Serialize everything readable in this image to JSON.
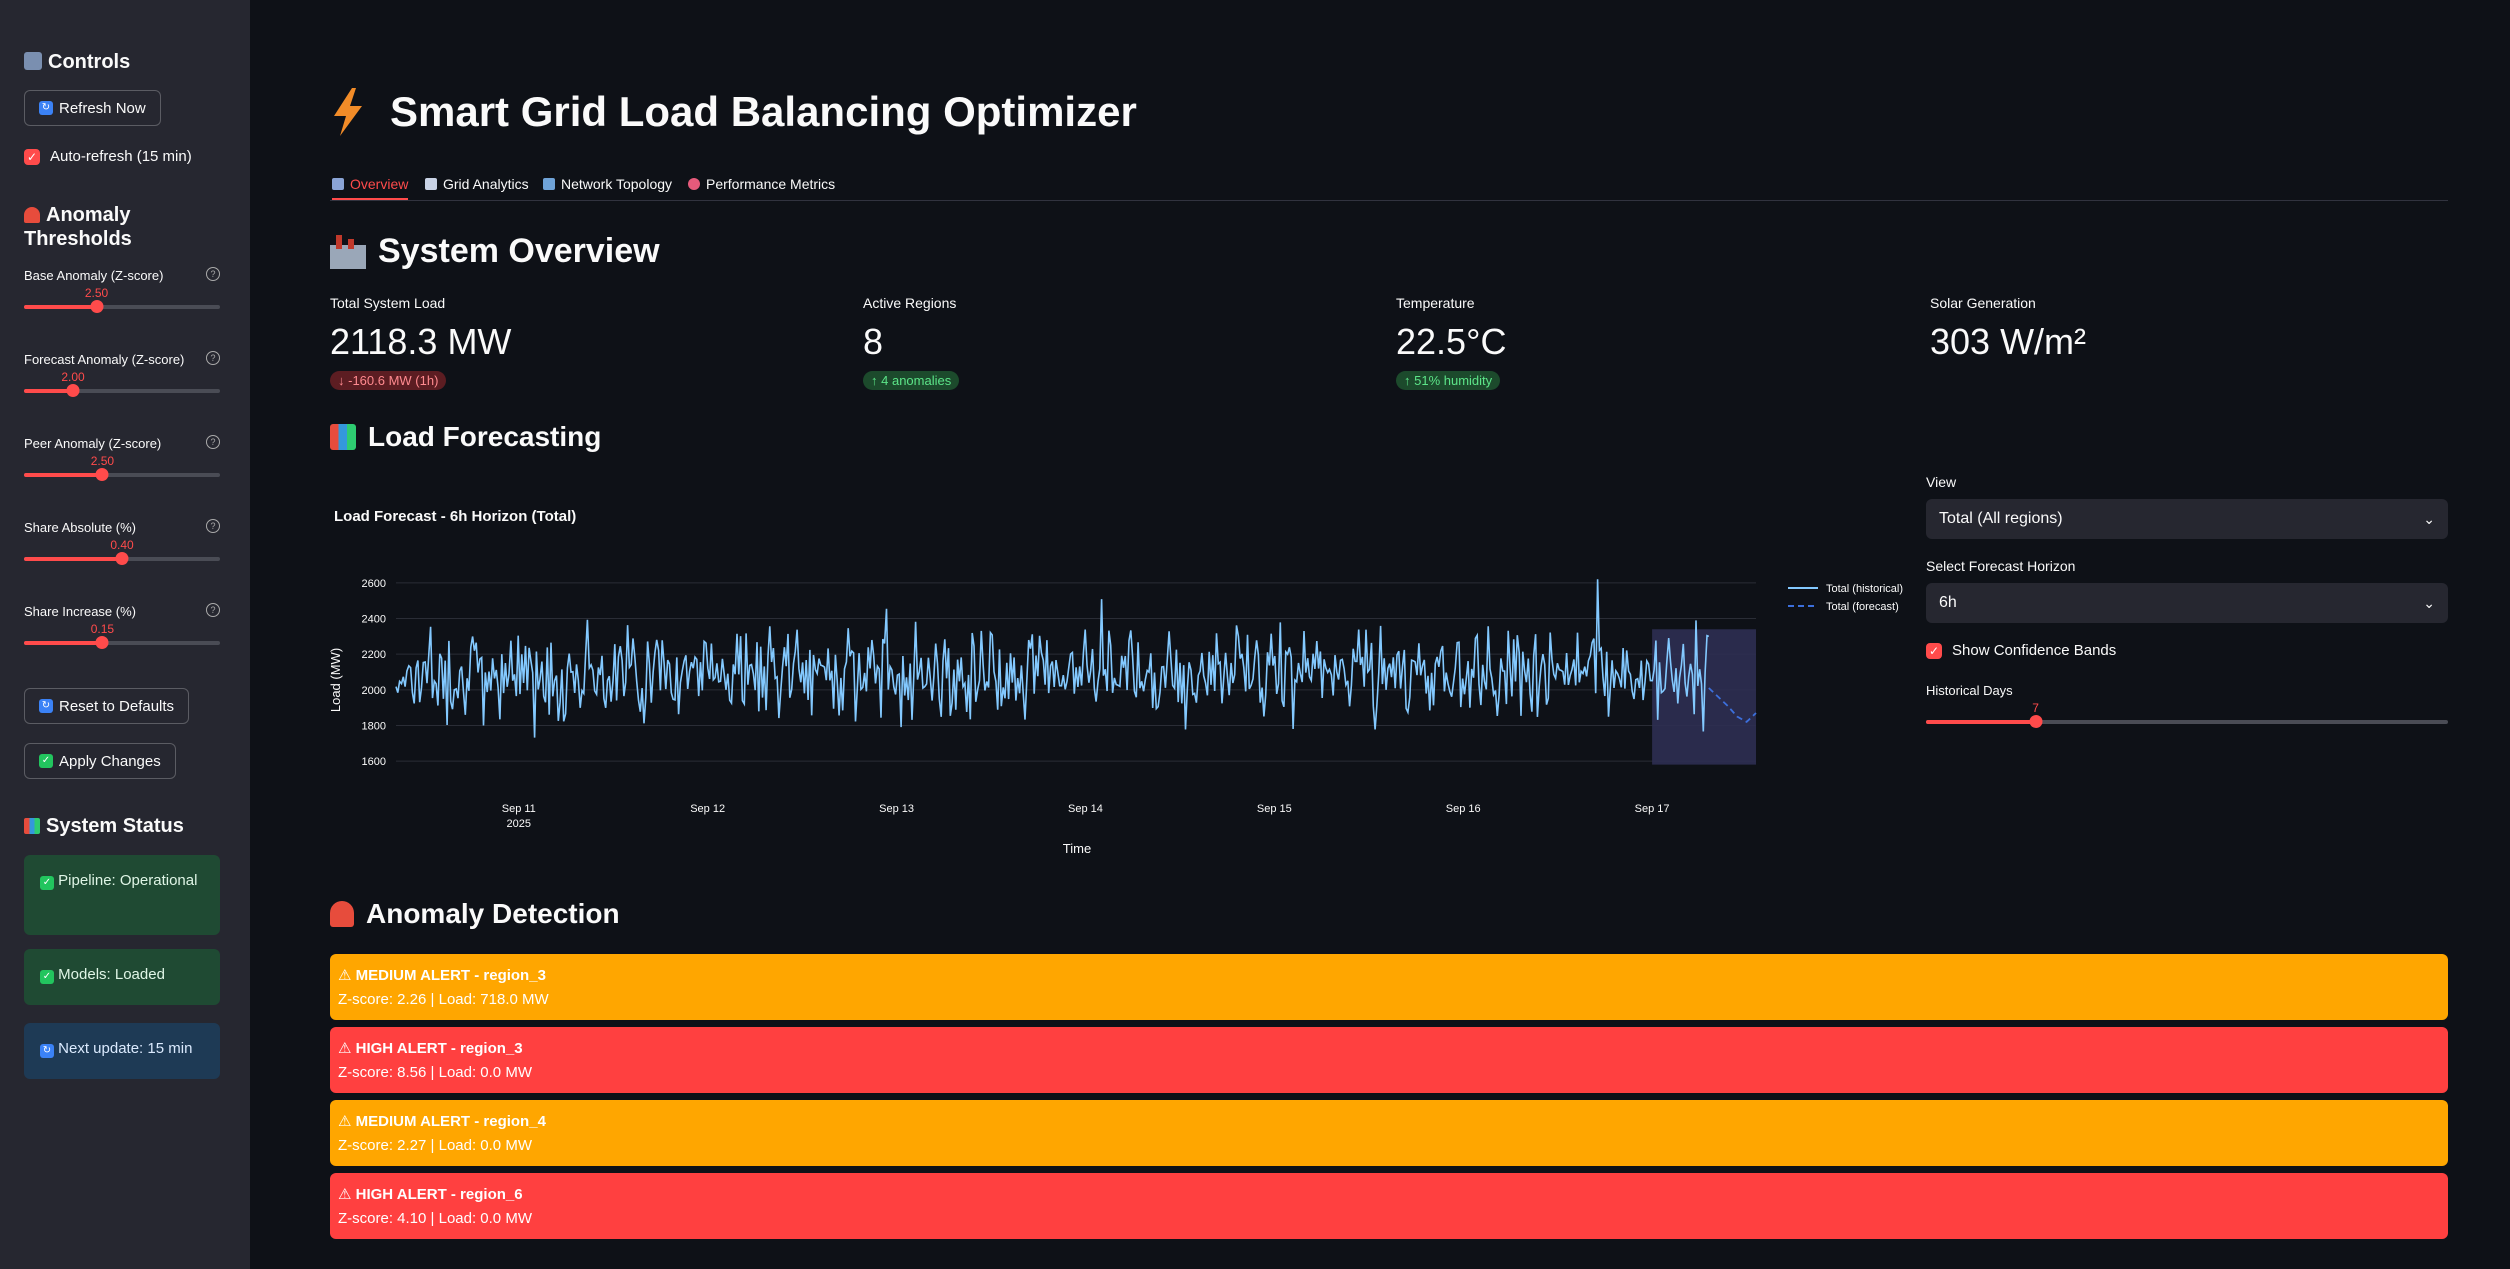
{
  "sidebar": {
    "controls_title": "Controls",
    "refresh_label": "Refresh Now",
    "autorefresh_label": "Auto-refresh (15 min)",
    "anomaly_title": "Anomaly Thresholds",
    "sliders": [
      {
        "label": "Base Anomaly (Z-score)",
        "value": "2.50",
        "fraction": 0.37
      },
      {
        "label": "Forecast Anomaly (Z-score)",
        "value": "2.00",
        "fraction": 0.25
      },
      {
        "label": "Peer Anomaly (Z-score)",
        "value": "2.50",
        "fraction": 0.4
      },
      {
        "label": "Share Absolute (%)",
        "value": "0.40",
        "fraction": 0.5
      },
      {
        "label": "Share Increase (%)",
        "value": "0.15",
        "fraction": 0.4
      }
    ],
    "reset_label": "Reset to Defaults",
    "apply_label": "Apply Changes",
    "status_title": "System Status",
    "status_pipeline": "Pipeline: Operational",
    "status_models": "Models: Loaded",
    "status_next": "Next update: 15 min"
  },
  "header": {
    "title": "Smart Grid Load Balancing Optimizer"
  },
  "tabs": [
    {
      "label": "Overview",
      "active": true
    },
    {
      "label": "Grid Analytics",
      "active": false
    },
    {
      "label": "Network Topology",
      "active": false
    },
    {
      "label": "Performance Metrics",
      "active": false
    }
  ],
  "overview": {
    "title": "System Overview",
    "metrics": [
      {
        "label": "Total System Load",
        "value": "2118.3 MW",
        "delta": "-160.6 MW (1h)",
        "delta_dir": "down"
      },
      {
        "label": "Active Regions",
        "value": "8",
        "delta": "4 anomalies",
        "delta_dir": "up"
      },
      {
        "label": "Temperature",
        "value": "22.5°C",
        "delta": "51% humidity",
        "delta_dir": "up"
      },
      {
        "label": "Solar Generation",
        "value": "303 W/m²",
        "delta": "",
        "delta_dir": ""
      }
    ]
  },
  "forecast": {
    "title": "Load Forecasting",
    "view_label": "View",
    "view_value": "Total (All regions)",
    "horizon_label": "Select Forecast Horizon",
    "horizon_value": "6h",
    "confidence_label": "Show Confidence Bands",
    "days_label": "Historical Days",
    "days_value": "7",
    "days_fraction": 0.21
  },
  "chart_data": {
    "type": "line",
    "title": "Load Forecast - 6h Horizon (Total)",
    "xlabel": "Time",
    "ylabel": "Load (MW)",
    "ylim": [
      1550,
      2650
    ],
    "yticks": [
      1600,
      1800,
      2000,
      2200,
      2400,
      2600
    ],
    "xticks": [
      {
        "label": "Sep 11",
        "sub": "2025"
      },
      {
        "label": "Sep 12",
        "sub": ""
      },
      {
        "label": "Sep 13",
        "sub": ""
      },
      {
        "label": "Sep 14",
        "sub": ""
      },
      {
        "label": "Sep 15",
        "sub": ""
      },
      {
        "label": "Sep 16",
        "sub": ""
      },
      {
        "label": "Sep 17",
        "sub": ""
      }
    ],
    "x_range_days": [
      -0.65,
      6.55
    ],
    "grid": true,
    "legend_position": "top-right",
    "series": [
      {
        "name": "Total (historical)",
        "style": "solid",
        "color": "#83c9ff",
        "x_start_day": -0.65,
        "x_end_day": 6.3,
        "mean": 2100,
        "spread": 230
      },
      {
        "name": "Total (forecast)",
        "style": "dashed",
        "color": "#3c6fdc",
        "x_start_day": 6.3,
        "x_end_day": 6.55,
        "values": [
          2010,
          1960,
          1910,
          1850,
          1820,
          1870
        ]
      }
    ],
    "confidence_band": {
      "color": "#2d2f52",
      "x_start_day": 6.0,
      "x_end_day": 6.55,
      "lower": 1580,
      "upper": 2340
    }
  },
  "anomaly": {
    "title": "Anomaly Detection",
    "alerts": [
      {
        "level": "medium",
        "title": "MEDIUM ALERT - region_3",
        "detail": "Z-score: 2.26 | Load: 718.0 MW"
      },
      {
        "level": "high",
        "title": "HIGH ALERT - region_3",
        "detail": "Z-score: 8.56 | Load: 0.0 MW"
      },
      {
        "level": "medium",
        "title": "MEDIUM ALERT - region_4",
        "detail": "Z-score: 2.27 | Load: 0.0 MW"
      },
      {
        "level": "high",
        "title": "HIGH ALERT - region_6",
        "detail": "Z-score: 4.10 | Load: 0.0 MW"
      }
    ]
  },
  "colors": {
    "accent": "#ff4b4b",
    "sidebar_bg": "#262730",
    "page_bg": "#0e1117",
    "alert_medium": "#ffa600",
    "alert_high": "#ff4040"
  },
  "icons": [
    "control-knobs-icon",
    "refresh-icon",
    "siren-icon",
    "bar-chart-icon",
    "check-icon",
    "lightning-icon",
    "factory-icon"
  ]
}
